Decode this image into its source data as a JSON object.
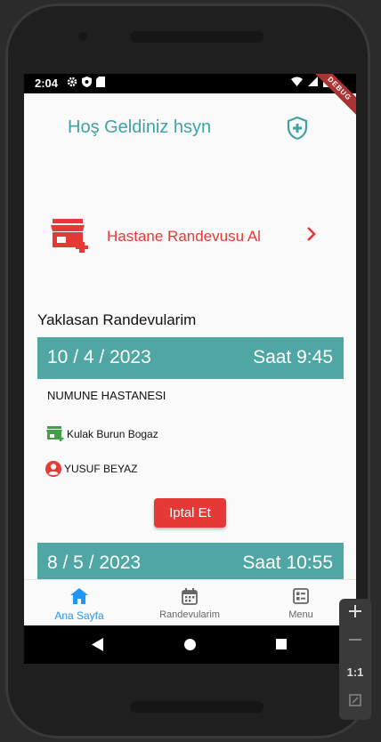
{
  "status_bar": {
    "time": "2:04",
    "debug_label": "DEBUG"
  },
  "header": {
    "welcome_text": "Hoş Geldiniz hsyn"
  },
  "hospital_action": {
    "label": "Hastane Randevusu Al"
  },
  "appointments": {
    "section_title": "Yaklasan Randevularim",
    "items": [
      {
        "date": "10 / 4 / 2023",
        "time": "Saat 9:45",
        "hospital": "NUMUNE HASTANESI",
        "department": "Kulak Burun Bogaz",
        "doctor": "YUSUF BEYAZ",
        "cancel_label": "Iptal Et"
      },
      {
        "date": "8 / 5 / 2023",
        "time": "Saat 10:55"
      }
    ]
  },
  "bottom_nav": {
    "items": [
      {
        "label": "Ana Sayfa",
        "icon": "home-icon",
        "active": true
      },
      {
        "label": "Randevularim",
        "icon": "calendar-icon",
        "active": false
      },
      {
        "label": "Menu",
        "icon": "menu-icon",
        "active": false
      }
    ]
  },
  "emulator_controls": {
    "zoom_ratio_label": "1:1"
  },
  "colors": {
    "teal_header": "#4fa6a3",
    "welcome_teal": "#3ea3a3",
    "accent_red": "#e53935",
    "nav_active": "#2196f3",
    "dept_icon_green": "#43a047"
  }
}
